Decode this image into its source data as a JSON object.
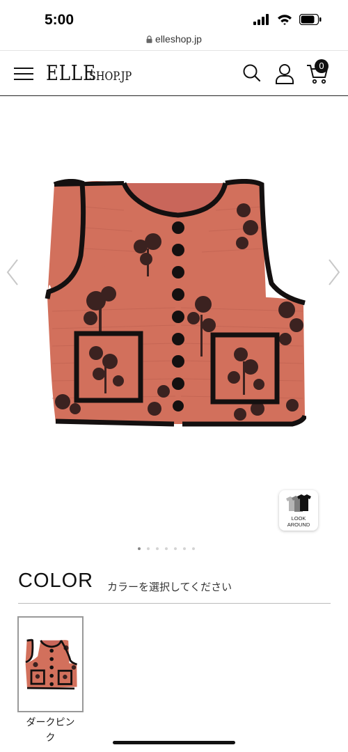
{
  "status": {
    "time": "5:00",
    "url": "elleshop.jp"
  },
  "header": {
    "logo_main": "ELLE",
    "logo_sub": "SHOP.JP",
    "cart_count": "0"
  },
  "product": {
    "look_around_line1": "LOOK",
    "look_around_line2": "AROUND",
    "slide_count": 7,
    "active_slide": 1
  },
  "color_section": {
    "heading": "COLOR",
    "instruction": "カラーを選択してください",
    "options": [
      {
        "label_line1": "ダークピン",
        "label_line2": "ク"
      }
    ]
  },
  "colors": {
    "vest": "#d2705c",
    "trim": "#141010",
    "print": "#3b2220"
  }
}
